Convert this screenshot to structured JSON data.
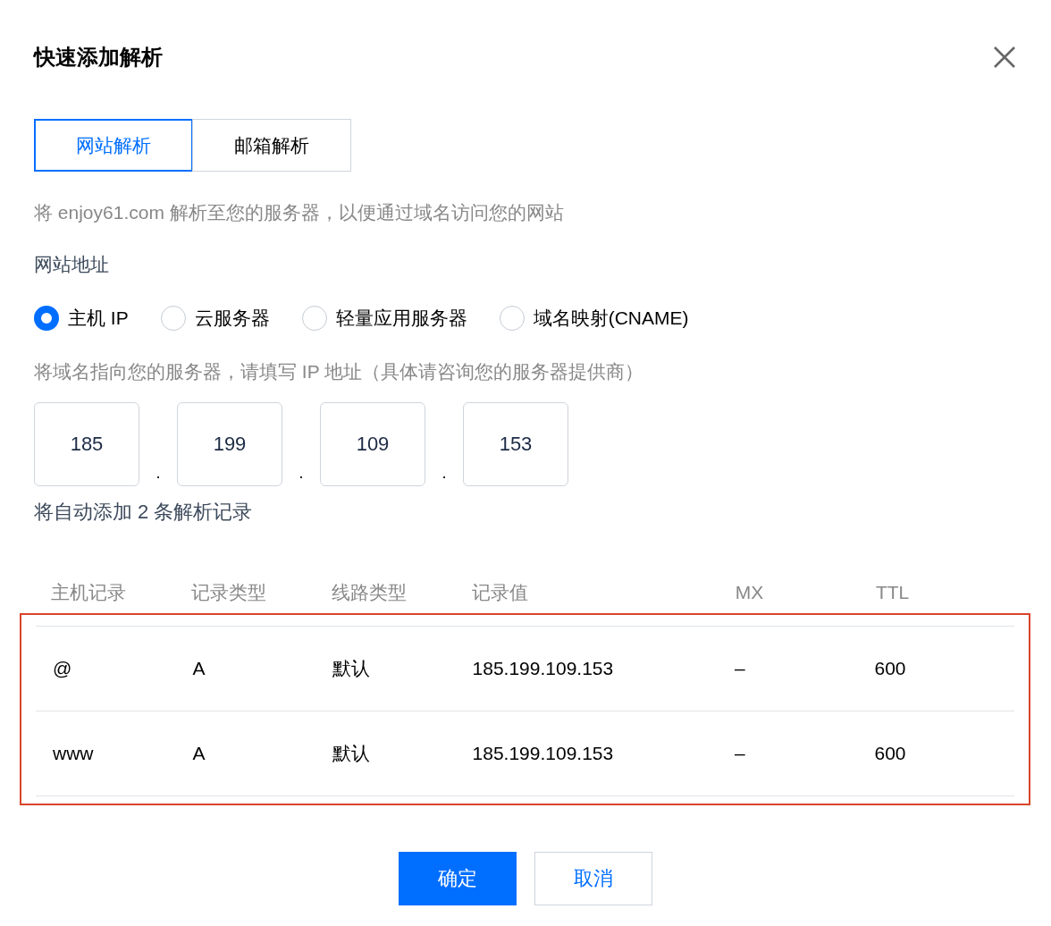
{
  "dialog": {
    "title": "快速添加解析"
  },
  "tabs": [
    {
      "label": "网站解析",
      "selected": true
    },
    {
      "label": "邮箱解析",
      "selected": false
    }
  ],
  "description": "将 enjoy61.com 解析至您的服务器，以便通过域名访问您的网站",
  "section_label": "网站地址",
  "radios": [
    {
      "label": "主机 IP",
      "selected": true
    },
    {
      "label": "云服务器",
      "selected": false
    },
    {
      "label": "轻量应用服务器",
      "selected": false
    },
    {
      "label": "域名映射(CNAME)",
      "selected": false
    }
  ],
  "ip_hint": "将域名指向您的服务器，请填写 IP 地址（具体请咨询您的服务器提供商）",
  "ip_inputs": [
    {
      "kind": "field",
      "text": "185"
    },
    {
      "kind": "dot",
      "text": "."
    },
    {
      "kind": "field",
      "text": "199"
    },
    {
      "kind": "dot",
      "text": "."
    },
    {
      "kind": "field",
      "text": "109"
    },
    {
      "kind": "dot",
      "text": "."
    },
    {
      "kind": "field",
      "text": "153"
    }
  ],
  "record_note": "将自动添加 2 条解析记录",
  "table": {
    "columns": [
      "主机记录",
      "记录类型",
      "线路类型",
      "记录值",
      "MX",
      "TTL"
    ],
    "rows": [
      [
        "@",
        "A",
        "默认",
        "185.199.109.153",
        "–",
        "600"
      ],
      [
        "www",
        "A",
        "默认",
        "185.199.109.153",
        "–",
        "600"
      ]
    ],
    "highlighted": true
  },
  "buttons": [
    {
      "label": "确定",
      "kind": "primary"
    },
    {
      "label": "取消",
      "kind": "secondary"
    }
  ]
}
